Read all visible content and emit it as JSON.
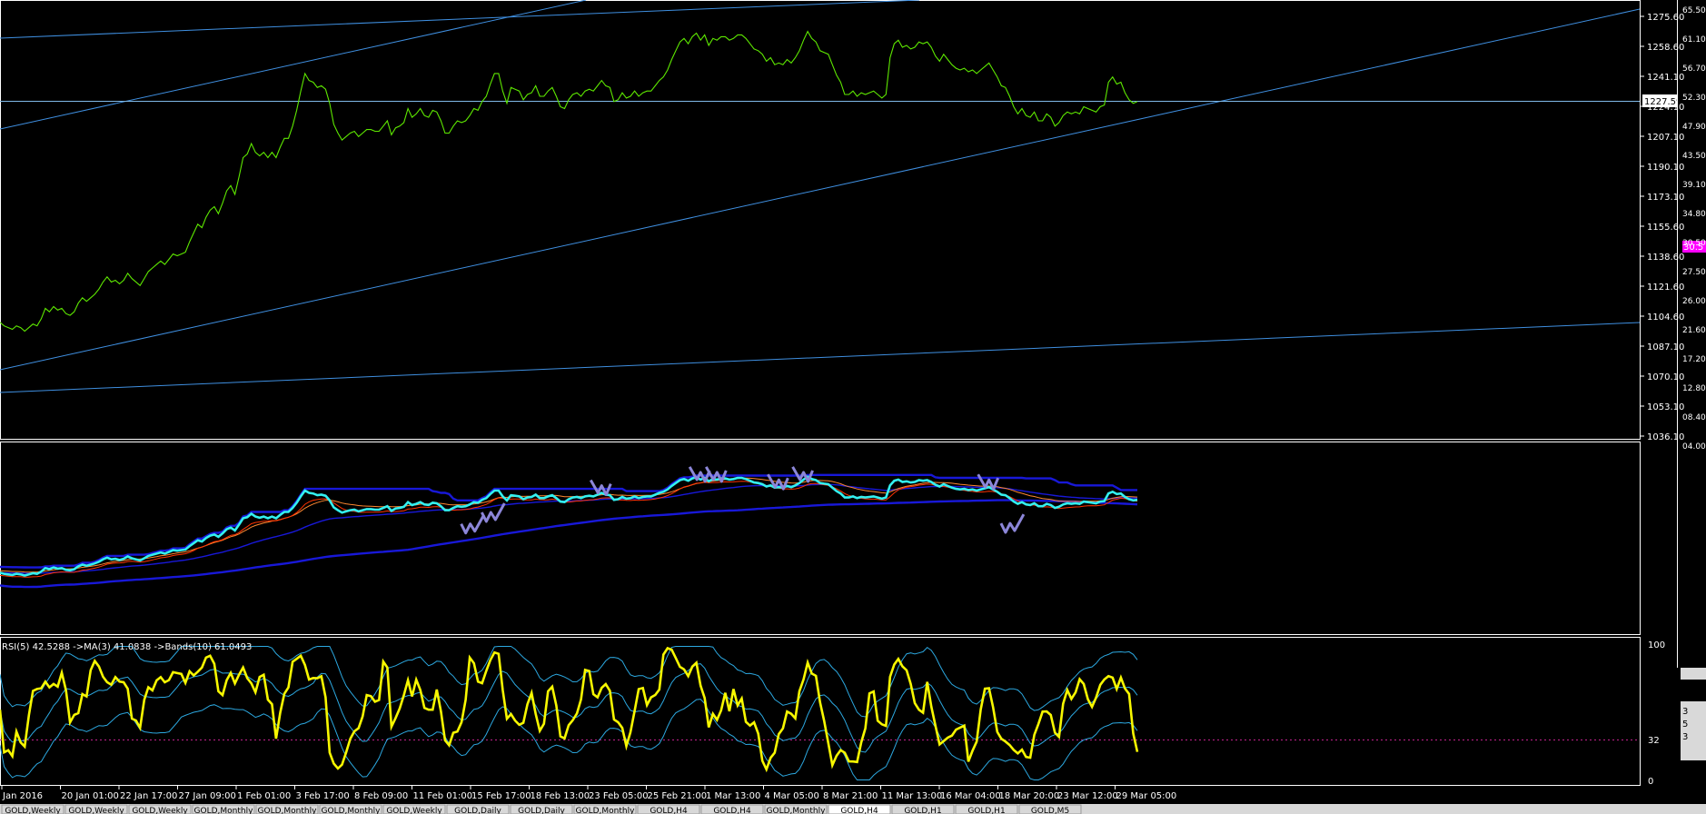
{
  "colors": {
    "background": "#000000",
    "frame": "#ffffff",
    "price_line": "#5ee800",
    "trendline": "#3f8fe0",
    "bid_line": "#7fb8e6",
    "fast_line": "#33f0f0",
    "band_line": "#1818d8",
    "ma_red": "#ff3300",
    "ma_orange": "#ff8830",
    "signal_arrow": "#8c86d8",
    "rsi_line": "#f8f800",
    "rsi_band": "#2ca8e0",
    "level_line": "#c0208c",
    "marker_magenta": "#ff00ff"
  },
  "main_panel": {
    "price_axis": [
      "1275.60",
      "1258.60",
      "1241.10",
      "1224.10",
      "1207.10",
      "1190.10",
      "1173.10",
      "1155.60",
      "1138.60",
      "1121.60",
      "1104.60",
      "1087.10",
      "1070.10",
      "1053.10",
      "1036.10"
    ],
    "current_price": "1227.59",
    "close_prices": [
      1101,
      1099,
      1098,
      1097,
      1099,
      1098,
      1096,
      1098,
      1100,
      1099,
      1103,
      1109,
      1107,
      1110,
      1108,
      1109,
      1106,
      1105,
      1107,
      1112,
      1115,
      1113,
      1115,
      1117,
      1120,
      1124,
      1127,
      1124,
      1125,
      1123,
      1125,
      1129,
      1126,
      1124,
      1122,
      1126,
      1130,
      1132,
      1134,
      1136,
      1134,
      1137,
      1140,
      1139,
      1140,
      1141,
      1147,
      1152,
      1157,
      1155,
      1161,
      1165,
      1167,
      1163,
      1169,
      1176,
      1179,
      1174,
      1184,
      1195,
      1197,
      1203,
      1198,
      1196,
      1198,
      1195,
      1198,
      1195,
      1201,
      1206,
      1206,
      1213,
      1222,
      1233,
      1243,
      1239,
      1238,
      1235,
      1236,
      1234,
      1226,
      1214,
      1209,
      1205,
      1207,
      1209,
      1210,
      1207,
      1209,
      1211,
      1211,
      1210,
      1210,
      1213,
      1216,
      1208,
      1212,
      1213,
      1215,
      1223,
      1218,
      1220,
      1223,
      1219,
      1218,
      1222,
      1221,
      1216,
      1209,
      1209,
      1213,
      1216,
      1215,
      1216,
      1219,
      1223,
      1222,
      1227,
      1230,
      1237,
      1243,
      1243,
      1233,
      1226,
      1235,
      1234,
      1233,
      1228,
      1231,
      1232,
      1236,
      1230,
      1230,
      1233,
      1235,
      1230,
      1224,
      1223,
      1228,
      1231,
      1232,
      1230,
      1233,
      1234,
      1233,
      1236,
      1239,
      1236,
      1235,
      1227,
      1228,
      1232,
      1229,
      1230,
      1233,
      1230,
      1232,
      1233,
      1233,
      1236,
      1239,
      1241,
      1245,
      1251,
      1256,
      1261,
      1263,
      1260,
      1264,
      1266,
      1262,
      1265,
      1259,
      1263,
      1262,
      1264,
      1264,
      1262,
      1263,
      1265,
      1265,
      1263,
      1260,
      1257,
      1256,
      1254,
      1250,
      1252,
      1248,
      1249,
      1248,
      1251,
      1249,
      1252,
      1256,
      1262,
      1267,
      1263,
      1261,
      1256,
      1255,
      1254,
      1248,
      1242,
      1238,
      1231,
      1231,
      1233,
      1230,
      1232,
      1231,
      1232,
      1233,
      1231,
      1229,
      1231,
      1252,
      1260,
      1262,
      1258,
      1259,
      1257,
      1258,
      1261,
      1260,
      1261,
      1258,
      1253,
      1250,
      1254,
      1251,
      1248,
      1246,
      1245,
      1246,
      1244,
      1245,
      1243,
      1245,
      1247,
      1249,
      1245,
      1241,
      1236,
      1235,
      1230,
      1224,
      1220,
      1223,
      1219,
      1218,
      1221,
      1216,
      1216,
      1220,
      1218,
      1213,
      1215,
      1219,
      1221,
      1220,
      1221,
      1220,
      1224,
      1223,
      1222,
      1221,
      1224,
      1225,
      1238,
      1241,
      1237,
      1238,
      1232,
      1228,
      1226,
      1227
    ]
  },
  "indicator_panel": {
    "signal_arrows": [
      {
        "bar": 115,
        "dir": "up"
      },
      {
        "bar": 120,
        "dir": "up"
      },
      {
        "bar": 146,
        "dir": "down"
      },
      {
        "bar": 170,
        "dir": "down"
      },
      {
        "bar": 174,
        "dir": "down"
      },
      {
        "bar": 189,
        "dir": "down"
      },
      {
        "bar": 195,
        "dir": "down"
      },
      {
        "bar": 240,
        "dir": "down"
      },
      {
        "bar": 246,
        "dir": "up"
      }
    ]
  },
  "rsi_panel": {
    "label": "RSI(5) 42.5288 ->MA(3) 41.0838 ->Bands(10) 61.0493",
    "scale_top": "100",
    "scale_mid": "32",
    "scale_bottom": "0",
    "level": 32
  },
  "time_axis": [
    "Jan 2016",
    "20 Jan 01:00",
    "22 Jan 17:00",
    "27 Jan 09:00",
    "1 Feb 01:00",
    "3 Feb 17:00",
    "8 Feb 09:00",
    "11 Feb 01:00",
    "15 Feb 17:00",
    "18 Feb 13:00",
    "23 Feb 05:00",
    "25 Feb 21:00",
    "1 Mar 13:00",
    "4 Mar 05:00",
    "8 Mar 21:00",
    "11 Mar 13:00",
    "16 Mar 04:00",
    "18 Mar 20:00",
    "23 Mar 12:00",
    "29 Mar 05:00"
  ],
  "right_strip": {
    "labels": [
      "65.50",
      "61.10",
      "56.70",
      "52.30",
      "47.90",
      "43.50",
      "39.10",
      "34.80",
      "30.50",
      "27.50",
      "26.00",
      "21.60",
      "17.20",
      "12.80",
      "08.40",
      "04.00"
    ],
    "highlight": "30.5",
    "lower_glyphs": [
      "e",
      "3",
      "5",
      "3"
    ]
  },
  "tabs": [
    "GOLD,Weekly",
    "GOLD,Weekly",
    "GOLD,Weekly",
    "GOLD,Monthly",
    "GOLD,Monthly",
    "GOLD,Monthly",
    "GOLD,Weekly",
    "GOLD,Daily",
    "GOLD,Daily",
    "GOLD,Monthly",
    "GOLD,H4",
    "GOLD,H4",
    "GOLD,Monthly",
    "GOLD,H4",
    "GOLD,H1",
    "GOLD,H1",
    "GOLD,M5"
  ],
  "active_tab": 13
}
